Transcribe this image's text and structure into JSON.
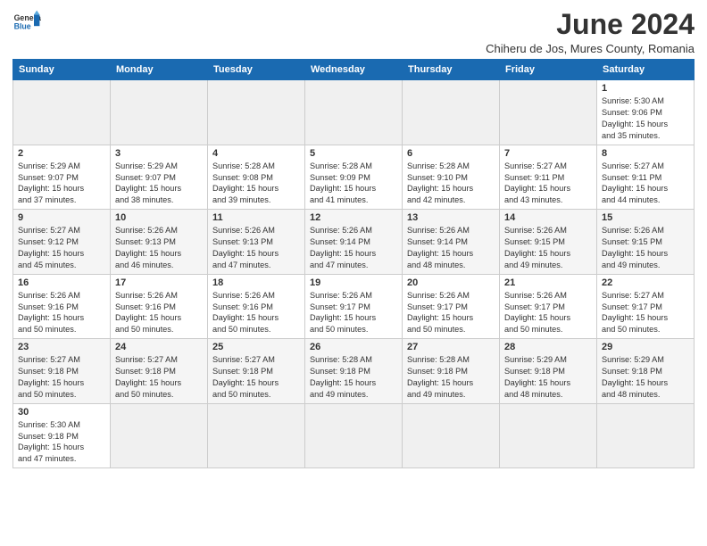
{
  "header": {
    "logo_general": "General",
    "logo_blue": "Blue",
    "month_title": "June 2024",
    "subtitle": "Chiheru de Jos, Mures County, Romania"
  },
  "weekdays": [
    "Sunday",
    "Monday",
    "Tuesday",
    "Wednesday",
    "Thursday",
    "Friday",
    "Saturday"
  ],
  "weeks": [
    [
      {
        "day": "",
        "info": ""
      },
      {
        "day": "",
        "info": ""
      },
      {
        "day": "",
        "info": ""
      },
      {
        "day": "",
        "info": ""
      },
      {
        "day": "",
        "info": ""
      },
      {
        "day": "",
        "info": ""
      },
      {
        "day": "1",
        "info": "Sunrise: 5:30 AM\nSunset: 9:06 PM\nDaylight: 15 hours\nand 35 minutes."
      }
    ],
    [
      {
        "day": "2",
        "info": "Sunrise: 5:29 AM\nSunset: 9:07 PM\nDaylight: 15 hours\nand 37 minutes."
      },
      {
        "day": "3",
        "info": "Sunrise: 5:29 AM\nSunset: 9:07 PM\nDaylight: 15 hours\nand 38 minutes."
      },
      {
        "day": "4",
        "info": "Sunrise: 5:28 AM\nSunset: 9:08 PM\nDaylight: 15 hours\nand 39 minutes."
      },
      {
        "day": "5",
        "info": "Sunrise: 5:28 AM\nSunset: 9:09 PM\nDaylight: 15 hours\nand 41 minutes."
      },
      {
        "day": "6",
        "info": "Sunrise: 5:28 AM\nSunset: 9:10 PM\nDaylight: 15 hours\nand 42 minutes."
      },
      {
        "day": "7",
        "info": "Sunrise: 5:27 AM\nSunset: 9:11 PM\nDaylight: 15 hours\nand 43 minutes."
      },
      {
        "day": "8",
        "info": "Sunrise: 5:27 AM\nSunset: 9:11 PM\nDaylight: 15 hours\nand 44 minutes."
      }
    ],
    [
      {
        "day": "9",
        "info": "Sunrise: 5:27 AM\nSunset: 9:12 PM\nDaylight: 15 hours\nand 45 minutes."
      },
      {
        "day": "10",
        "info": "Sunrise: 5:26 AM\nSunset: 9:13 PM\nDaylight: 15 hours\nand 46 minutes."
      },
      {
        "day": "11",
        "info": "Sunrise: 5:26 AM\nSunset: 9:13 PM\nDaylight: 15 hours\nand 47 minutes."
      },
      {
        "day": "12",
        "info": "Sunrise: 5:26 AM\nSunset: 9:14 PM\nDaylight: 15 hours\nand 47 minutes."
      },
      {
        "day": "13",
        "info": "Sunrise: 5:26 AM\nSunset: 9:14 PM\nDaylight: 15 hours\nand 48 minutes."
      },
      {
        "day": "14",
        "info": "Sunrise: 5:26 AM\nSunset: 9:15 PM\nDaylight: 15 hours\nand 49 minutes."
      },
      {
        "day": "15",
        "info": "Sunrise: 5:26 AM\nSunset: 9:15 PM\nDaylight: 15 hours\nand 49 minutes."
      }
    ],
    [
      {
        "day": "16",
        "info": "Sunrise: 5:26 AM\nSunset: 9:16 PM\nDaylight: 15 hours\nand 50 minutes."
      },
      {
        "day": "17",
        "info": "Sunrise: 5:26 AM\nSunset: 9:16 PM\nDaylight: 15 hours\nand 50 minutes."
      },
      {
        "day": "18",
        "info": "Sunrise: 5:26 AM\nSunset: 9:16 PM\nDaylight: 15 hours\nand 50 minutes."
      },
      {
        "day": "19",
        "info": "Sunrise: 5:26 AM\nSunset: 9:17 PM\nDaylight: 15 hours\nand 50 minutes."
      },
      {
        "day": "20",
        "info": "Sunrise: 5:26 AM\nSunset: 9:17 PM\nDaylight: 15 hours\nand 50 minutes."
      },
      {
        "day": "21",
        "info": "Sunrise: 5:26 AM\nSunset: 9:17 PM\nDaylight: 15 hours\nand 50 minutes."
      },
      {
        "day": "22",
        "info": "Sunrise: 5:27 AM\nSunset: 9:17 PM\nDaylight: 15 hours\nand 50 minutes."
      }
    ],
    [
      {
        "day": "23",
        "info": "Sunrise: 5:27 AM\nSunset: 9:18 PM\nDaylight: 15 hours\nand 50 minutes."
      },
      {
        "day": "24",
        "info": "Sunrise: 5:27 AM\nSunset: 9:18 PM\nDaylight: 15 hours\nand 50 minutes."
      },
      {
        "day": "25",
        "info": "Sunrise: 5:27 AM\nSunset: 9:18 PM\nDaylight: 15 hours\nand 50 minutes."
      },
      {
        "day": "26",
        "info": "Sunrise: 5:28 AM\nSunset: 9:18 PM\nDaylight: 15 hours\nand 49 minutes."
      },
      {
        "day": "27",
        "info": "Sunrise: 5:28 AM\nSunset: 9:18 PM\nDaylight: 15 hours\nand 49 minutes."
      },
      {
        "day": "28",
        "info": "Sunrise: 5:29 AM\nSunset: 9:18 PM\nDaylight: 15 hours\nand 48 minutes."
      },
      {
        "day": "29",
        "info": "Sunrise: 5:29 AM\nSunset: 9:18 PM\nDaylight: 15 hours\nand 48 minutes."
      }
    ],
    [
      {
        "day": "30",
        "info": "Sunrise: 5:30 AM\nSunset: 9:18 PM\nDaylight: 15 hours\nand 47 minutes."
      },
      {
        "day": "",
        "info": ""
      },
      {
        "day": "",
        "info": ""
      },
      {
        "day": "",
        "info": ""
      },
      {
        "day": "",
        "info": ""
      },
      {
        "day": "",
        "info": ""
      },
      {
        "day": "",
        "info": ""
      }
    ]
  ]
}
